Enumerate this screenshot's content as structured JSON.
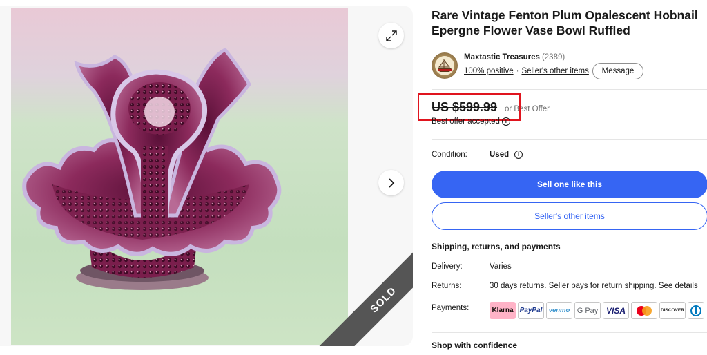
{
  "gallery": {
    "sold_label": "SOLD"
  },
  "listing": {
    "title": "Rare Vintage Fenton Plum Opalescent Hobnail Epergne Flower Vase Bowl Ruffled"
  },
  "seller": {
    "name": "Maxtastic Treasures",
    "count": "(2389)",
    "positive": "100% positive",
    "other_items": "Seller's other items",
    "message_label": "Message"
  },
  "price": {
    "amount": "US $599.99",
    "or_best_offer": "or Best Offer",
    "offer_accepted": "Best offer accepted"
  },
  "condition": {
    "label": "Condition:",
    "value": "Used"
  },
  "actions": {
    "sell_one": "Sell one like this",
    "other_items": "Seller's other items"
  },
  "shipping": {
    "title": "Shipping, returns, and payments",
    "delivery_label": "Delivery:",
    "delivery_value": "Varies",
    "returns_label": "Returns:",
    "returns_value": "30 days returns. Seller pays for return shipping.",
    "returns_link": "See details",
    "payments_label": "Payments:"
  },
  "payments": [
    "Klarna",
    "PayPal",
    "venmo",
    "G Pay",
    "VISA",
    "",
    "DISCOVER"
  ],
  "confidence": {
    "title": "Shop with confidence"
  },
  "colors": {
    "primary": "#3665f3",
    "highlight": "#e0141e",
    "sold_band": "#555555"
  }
}
